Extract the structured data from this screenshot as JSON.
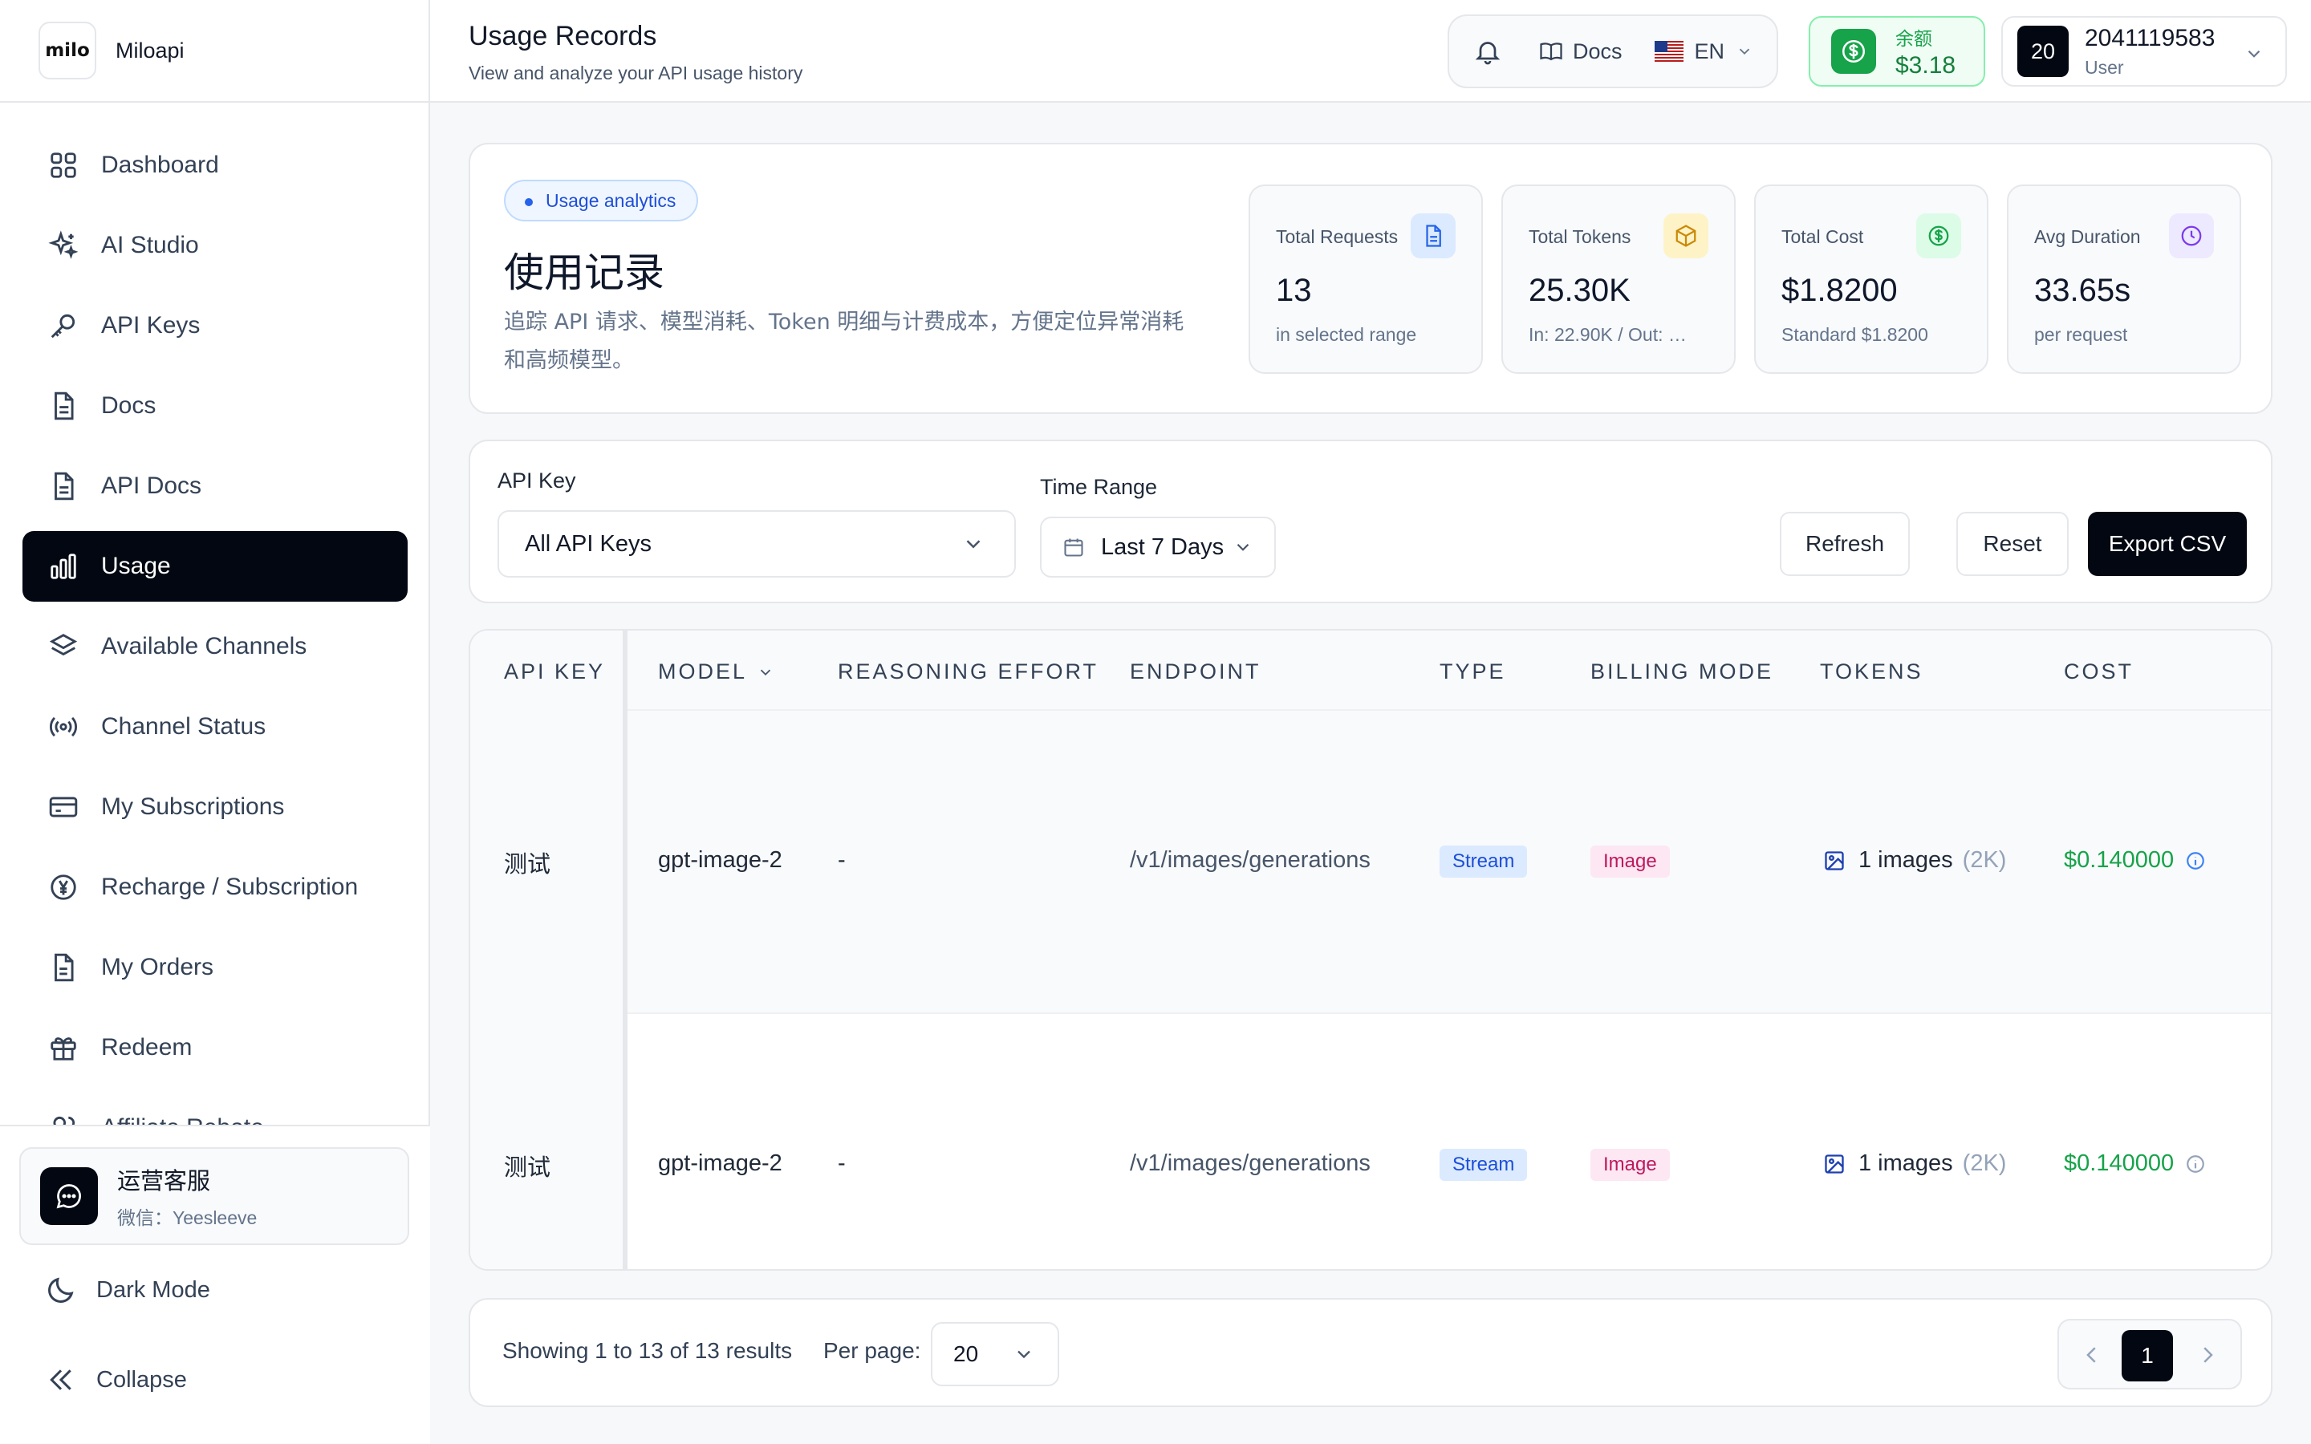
{
  "brand": {
    "logo_text": "milo",
    "name": "Miloapi"
  },
  "sidebar": {
    "items": [
      {
        "label": "Dashboard",
        "icon": "grid-icon"
      },
      {
        "label": "AI Studio",
        "icon": "sparkles-icon"
      },
      {
        "label": "API Keys",
        "icon": "key-icon"
      },
      {
        "label": "Docs",
        "icon": "document-icon"
      },
      {
        "label": "API Docs",
        "icon": "document-icon"
      },
      {
        "label": "Usage",
        "icon": "bar-chart-icon",
        "active": true
      },
      {
        "label": "Available Channels",
        "icon": "layers-icon"
      },
      {
        "label": "Channel Status",
        "icon": "signal-icon"
      },
      {
        "label": "My Subscriptions",
        "icon": "credit-card-icon"
      },
      {
        "label": "Recharge / Subscription",
        "icon": "yen-circle-icon"
      },
      {
        "label": "My Orders",
        "icon": "file-icon"
      },
      {
        "label": "Redeem",
        "icon": "gift-icon"
      },
      {
        "label": "Affiliate Rebate",
        "icon": "users-icon"
      }
    ],
    "support": {
      "title": "运营客服",
      "subtitle": "微信：Yeesleeve"
    },
    "dark_mode_label": "Dark Mode",
    "collapse_label": "Collapse"
  },
  "header": {
    "title": "Usage Records",
    "subtitle": "View and analyze your API usage history",
    "docs_label": "Docs",
    "language": "EN",
    "balance_label": "余额",
    "balance_value": "$3.18",
    "avatar_text": "20",
    "user_name": "2041119583",
    "user_role": "User"
  },
  "summary": {
    "badge": "Usage analytics",
    "title": "使用记录",
    "description": "追踪 API 请求、模型消耗、Token 明细与计费成本，方便定位异常消耗和高频模型。",
    "stats": [
      {
        "label": "Total Requests",
        "value": "13",
        "sub": "in selected range",
        "icon": "document-icon",
        "color": "#2563eb",
        "bg": "#dbeafe"
      },
      {
        "label": "Total Tokens",
        "value": "25.30K",
        "sub": "In: 22.90K / Out: …",
        "icon": "box-icon",
        "color": "#ca8a04",
        "bg": "#fef3c7"
      },
      {
        "label": "Total Cost",
        "value": "$1.8200",
        "sub": "Standard $1.8200",
        "icon": "dollar-icon",
        "color": "#16a34a",
        "bg": "#dcfce7"
      },
      {
        "label": "Avg Duration",
        "value": "33.65s",
        "sub": "per request",
        "icon": "clock-icon",
        "color": "#7c3aed",
        "bg": "#ede9fe"
      }
    ]
  },
  "filters": {
    "api_key_label": "API Key",
    "api_key_value": "All API Keys",
    "time_range_label": "Time Range",
    "time_range_value": "Last 7 Days",
    "refresh_label": "Refresh",
    "reset_label": "Reset",
    "export_label": "Export CSV"
  },
  "table": {
    "columns": [
      "API KEY",
      "MODEL",
      "REASONING EFFORT",
      "ENDPOINT",
      "TYPE",
      "BILLING MODE",
      "TOKENS",
      "COST"
    ],
    "rows": [
      {
        "api_key": "测试",
        "model": "gpt-image-2",
        "reasoning": "-",
        "endpoint": "/v1/images/generations",
        "type": "Stream",
        "billing": "Image",
        "tokens": "1 images",
        "tokens_detail": "(2K)",
        "cost": "$0.140000"
      },
      {
        "api_key": "测试",
        "model": "gpt-image-2",
        "reasoning": "-",
        "endpoint": "/v1/images/generations",
        "type": "Stream",
        "billing": "Image",
        "tokens": "1 images",
        "tokens_detail": "(2K)",
        "cost": "$0.140000"
      }
    ]
  },
  "pagination": {
    "summary": "Showing 1 to 13 of 13 results",
    "per_page_label": "Per page:",
    "per_page_value": "20",
    "current_page": "1"
  }
}
